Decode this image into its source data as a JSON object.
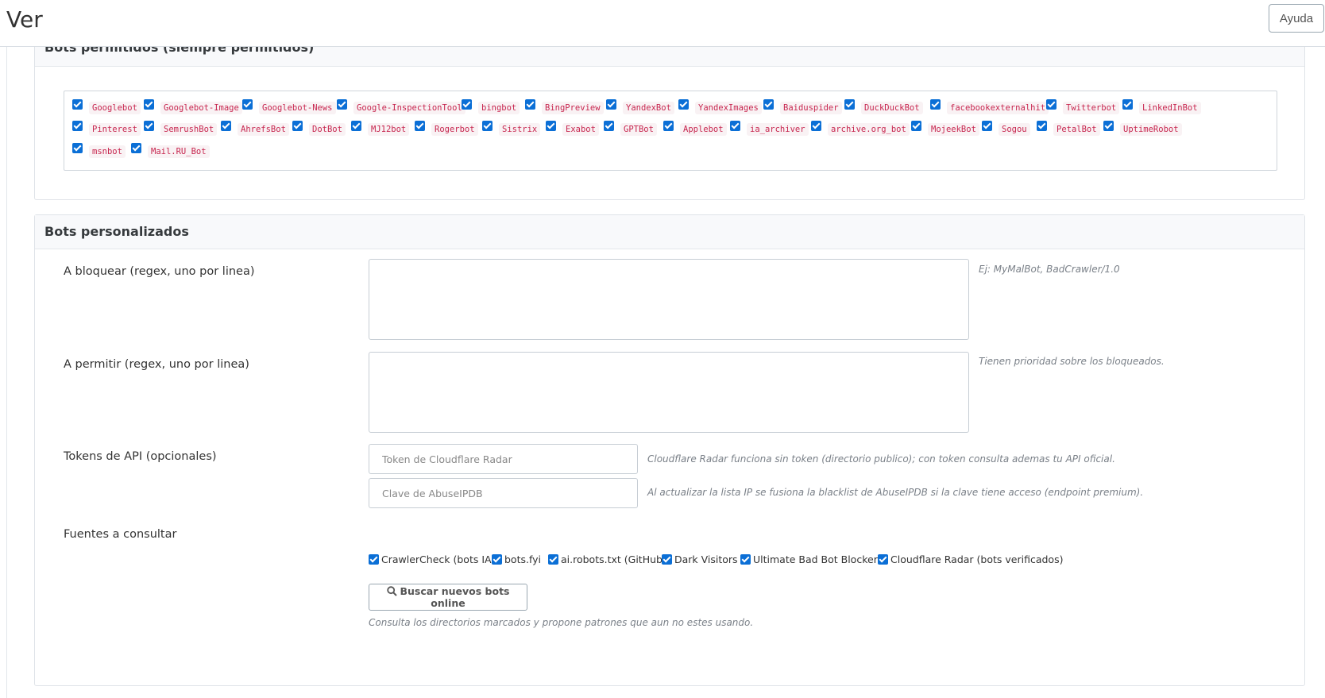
{
  "header": {
    "title": "Ver",
    "help_label": "Ayuda"
  },
  "allowed_panel": {
    "title": "Bots permitidos (siempre permitidos)",
    "rows": [
      [
        {
          "name": "Googlebot",
          "checked": true
        },
        {
          "name": "Googlebot-Image",
          "checked": true
        },
        {
          "name": "Googlebot-News",
          "checked": true
        },
        {
          "name": "Google-InspectionTool",
          "checked": true
        },
        {
          "name": "bingbot",
          "checked": true
        },
        {
          "name": "BingPreview",
          "checked": true
        },
        {
          "name": "YandexBot",
          "checked": true
        },
        {
          "name": "YandexImages",
          "checked": true
        },
        {
          "name": "Baiduspider",
          "checked": true
        },
        {
          "name": "DuckDuckBot",
          "checked": true
        },
        {
          "name": "facebookexternalhit",
          "checked": true
        },
        {
          "name": "Twitterbot",
          "checked": true
        },
        {
          "name": "LinkedInBot",
          "checked": true
        }
      ],
      [
        {
          "name": "Pinterest",
          "checked": true
        },
        {
          "name": "SemrushBot",
          "checked": true
        },
        {
          "name": "AhrefsBot",
          "checked": true
        },
        {
          "name": "DotBot",
          "checked": true
        },
        {
          "name": "MJ12bot",
          "checked": true
        },
        {
          "name": "Rogerbot",
          "checked": true
        },
        {
          "name": "Sistrix",
          "checked": true
        },
        {
          "name": "Exabot",
          "checked": true
        },
        {
          "name": "GPTBot",
          "checked": true
        },
        {
          "name": "Applebot",
          "checked": true
        },
        {
          "name": "ia_archiver",
          "checked": true
        },
        {
          "name": "archive.org_bot",
          "checked": true
        },
        {
          "name": "MojeekBot",
          "checked": true
        },
        {
          "name": "Sogou",
          "checked": true
        },
        {
          "name": "PetalBot",
          "checked": true
        },
        {
          "name": "UptimeRobot",
          "checked": true
        }
      ],
      [
        {
          "name": "msnbot",
          "checked": true
        },
        {
          "name": "Mail.RU_Bot",
          "checked": true
        }
      ]
    ]
  },
  "custom_panel": {
    "title": "Bots personalizados",
    "block_label": "A bloquear (regex, uno por linea)",
    "block_value": "",
    "block_hint": "Ej: MyMalBot, BadCrawler/1.0",
    "allow_label": "A permitir (regex, uno por linea)",
    "allow_value": "",
    "allow_hint": "Tienen prioridad sobre los bloqueados.",
    "tokens_label": "Tokens de API (opcionales)",
    "cloudflare_placeholder": "Token de Cloudflare Radar",
    "cloudflare_value": "",
    "cloudflare_hint": "Cloudflare Radar funciona sin token (directorio publico); con token consulta ademas tu API oficial.",
    "abuseipdb_placeholder": "Clave de AbuseIPDB",
    "abuseipdb_value": "",
    "abuseipdb_hint": "Al actualizar la lista IP se fusiona la blacklist de AbuseIPDB si la clave tiene acceso (endpoint premium).",
    "sources_label": "Fuentes a consultar",
    "sources": [
      {
        "label": "CrawlerCheck (bots IA)",
        "checked": true
      },
      {
        "label": "bots.fyi",
        "checked": true
      },
      {
        "label": "ai.robots.txt (GitHub)",
        "checked": true
      },
      {
        "label": "Dark Visitors",
        "checked": true
      },
      {
        "label": "Ultimate Bad Bot Blocker",
        "checked": true
      },
      {
        "label": "Cloudflare Radar (bots verificados)",
        "checked": true
      }
    ],
    "search_button_label": "Buscar nuevos bots online",
    "search_hint": "Consulta los directorios marcados y propone patrones que aun no estes usando."
  }
}
